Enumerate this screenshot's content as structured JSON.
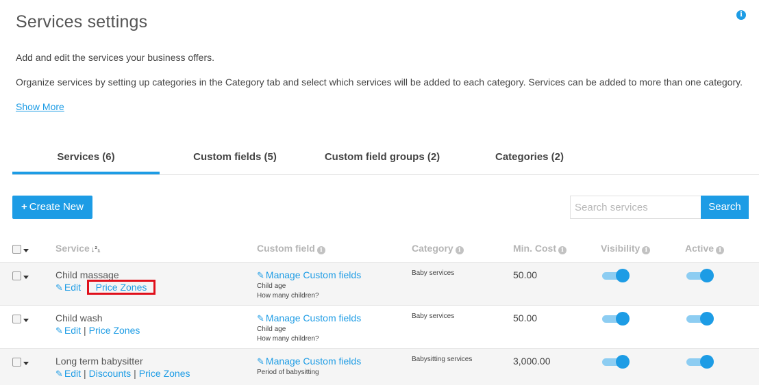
{
  "page": {
    "title": "Services settings",
    "info_icon": "i",
    "description_1": "Add and edit the services your business offers.",
    "description_2": "Organize services by setting up categories in the Category tab and select which services will be added to each category. Services can be added to more than one category.",
    "show_more": "Show More"
  },
  "tabs": [
    {
      "label": "Services (6)",
      "active": true
    },
    {
      "label": "Custom fields (5)",
      "active": false
    },
    {
      "label": "Custom field groups (2)",
      "active": false
    },
    {
      "label": "Categories (2)",
      "active": false
    }
  ],
  "toolbar": {
    "create_plus": "+",
    "create_label": "Create New",
    "search_placeholder": "Search services",
    "search_label": "Search"
  },
  "table": {
    "headers": {
      "service": "Service",
      "sort_icon": "↓²₁",
      "custom_field": "Custom field",
      "category": "Category",
      "min_cost": "Min. Cost",
      "visibility": "Visibility",
      "active": "Active",
      "info_glyph": "i"
    },
    "edit_glyph": "✎",
    "separator": "|",
    "manage_label": "Manage Custom fields",
    "rows": [
      {
        "name": "Child massage",
        "actions": [
          "Edit",
          "Price Zones"
        ],
        "custom_fields": [
          "Child age",
          "How many children?"
        ],
        "category": "Baby services",
        "min_cost": "50.00",
        "visibility": true,
        "active": true
      },
      {
        "name": "Child wash",
        "actions": [
          "Edit",
          "Price Zones"
        ],
        "custom_fields": [
          "Child age",
          "How many children?"
        ],
        "category": "Baby services",
        "min_cost": "50.00",
        "visibility": true,
        "active": true
      },
      {
        "name": "Long term babysitter",
        "actions": [
          "Edit",
          "Discounts",
          "Price Zones"
        ],
        "custom_fields": [
          "Period of babysitting"
        ],
        "category": "Babysitting services",
        "min_cost": "3,000.00",
        "visibility": true,
        "active": true
      }
    ]
  },
  "colors": {
    "accent": "#1d9ce5",
    "highlight": "#e0101b",
    "toggle_track": "#8dcdf2"
  },
  "icons": [
    "info-icon",
    "plus-icon",
    "sort-alpha-icon",
    "edit-icon",
    "caret-down-icon",
    "checkbox-icon",
    "toggle-icon"
  ]
}
